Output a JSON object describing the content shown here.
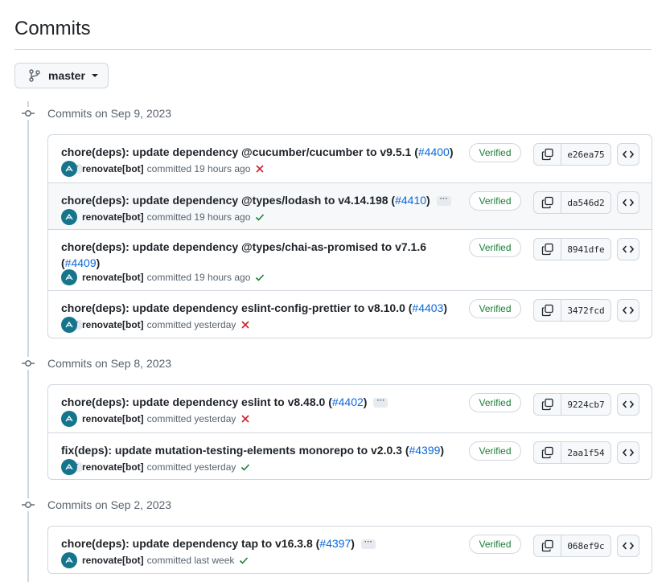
{
  "page": {
    "title": "Commits"
  },
  "branch": {
    "name": "master"
  },
  "colors": {
    "verified": "#1a7f37",
    "link": "#0969da",
    "fail": "#cf222e",
    "success": "#1a7f37",
    "avatar": "#15758c"
  },
  "groups": [
    {
      "label": "Commits on Sep 9, 2023",
      "commits": [
        {
          "message": "chore(deps): update dependency @cucumber/cucumber to v9.5.1 (",
          "pr": "#4400",
          "pr_close": ")",
          "author": "renovate[bot]",
          "time": "committed 19 hours ago",
          "status": "fail",
          "verified": "Verified",
          "sha": "e26ea75"
        },
        {
          "message": "chore(deps): update dependency @types/lodash to v4.14.198 (",
          "pr": "#4410",
          "pr_close": ")",
          "author": "renovate[bot]",
          "time": "committed 19 hours ago",
          "status": "success",
          "verified": "Verified",
          "sha": "da546d2"
        },
        {
          "message": "chore(deps): update dependency @types/chai-as-promised to v7.1.6 (",
          "pr": "#4409",
          "pr_close": ")",
          "author": "renovate[bot]",
          "time": "committed 19 hours ago",
          "status": "success",
          "verified": "Verified",
          "sha": "8941dfe"
        },
        {
          "message": "chore(deps): update dependency eslint-config-prettier to v8.10.0 (",
          "pr": "#4403",
          "pr_close": ")",
          "author": "renovate[bot]",
          "time": "committed yesterday",
          "status": "fail",
          "verified": "Verified",
          "sha": "3472fcd"
        }
      ]
    },
    {
      "label": "Commits on Sep 8, 2023",
      "commits": [
        {
          "message": "chore(deps): update dependency eslint to v8.48.0 (",
          "pr": "#4402",
          "pr_close": ")",
          "author": "renovate[bot]",
          "time": "committed yesterday",
          "status": "fail",
          "verified": "Verified",
          "sha": "9224cb7"
        },
        {
          "message": "fix(deps): update mutation-testing-elements monorepo to v2.0.3 (",
          "pr": "#4399",
          "pr_close": ")",
          "author": "renovate[bot]",
          "time": "committed yesterday",
          "status": "success",
          "verified": "Verified",
          "sha": "2aa1f54"
        }
      ]
    },
    {
      "label": "Commits on Sep 2, 2023",
      "commits": [
        {
          "message": "chore(deps): update dependency tap to v16.3.8 (",
          "pr": "#4397",
          "pr_close": ")",
          "author": "renovate[bot]",
          "time": "committed last week",
          "status": "success",
          "verified": "Verified",
          "sha": "068ef9c"
        }
      ]
    }
  ],
  "icons": {
    "branch": "git-branch-icon",
    "commit": "git-commit-icon",
    "copy": "copy-icon",
    "browse": "code-icon",
    "fail": "x-icon",
    "success": "check-icon",
    "more": "ellipsis-icon"
  }
}
